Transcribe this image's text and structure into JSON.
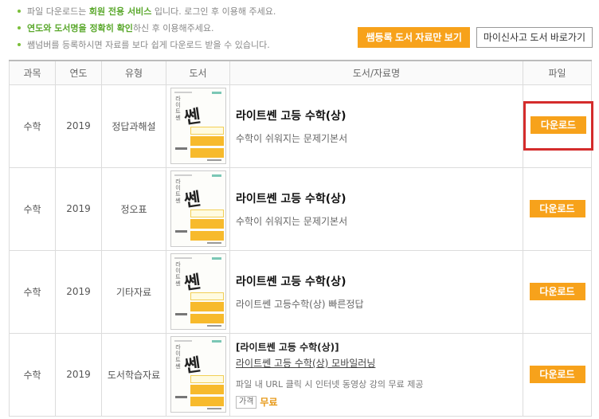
{
  "notices": [
    {
      "parts": [
        "파일 다운로드는 ",
        "회원 전용 서비스",
        " 입니다. 로그인 후 이용해 주세요."
      ]
    },
    {
      "parts": [
        "",
        "연도와 도서명을 정확히 확인",
        "하신 후 이용해주세요."
      ]
    },
    {
      "parts": [
        "쌤넘버를 등록하시면 자료를 보다 쉽게 다운로드 받을 수 있습니다.",
        "",
        ""
      ]
    }
  ],
  "buttons": {
    "registered_only": "쌤등록 도서 자료만 보기",
    "my_books": "마이신사고 도서 바로가기"
  },
  "table": {
    "headers": [
      "과목",
      "연도",
      "유형",
      "도서",
      "도서/자료명",
      "파일"
    ],
    "download_label": "다운로드",
    "cover": {
      "vertical": "라이트쎈",
      "big": "쎈"
    },
    "rows": [
      {
        "subject": "수학",
        "year": "2019",
        "type": "정답과해설",
        "title": "라이트쎈 고등 수학(상)",
        "subtitle": "수학이 쉬워지는 문제기본서"
      },
      {
        "subject": "수학",
        "year": "2019",
        "type": "정오표",
        "title": "라이트쎈 고등 수학(상)",
        "subtitle": "수학이 쉬워지는 문제기본서"
      },
      {
        "subject": "수학",
        "year": "2019",
        "type": "기타자료",
        "title": "라이트쎈 고등 수학(상)",
        "subtitle": "라이트쎈 고등수학(상) 빠른정답"
      },
      {
        "subject": "수학",
        "year": "2019",
        "type": "도서학습자료",
        "title": "[라이트쎈 고등 수학(상)]",
        "link": "라이트쎈 고등 수학(상) 모바일러닝",
        "desc": "파일 내 URL 클릭 시 인터넷 동영상 강의 무료 제공",
        "price_label": "가격",
        "price": "무료"
      }
    ]
  },
  "colors": {
    "accent": "#f7a21b",
    "highlight_border": "#d42c2c",
    "notice_green": "#5aa82c"
  }
}
